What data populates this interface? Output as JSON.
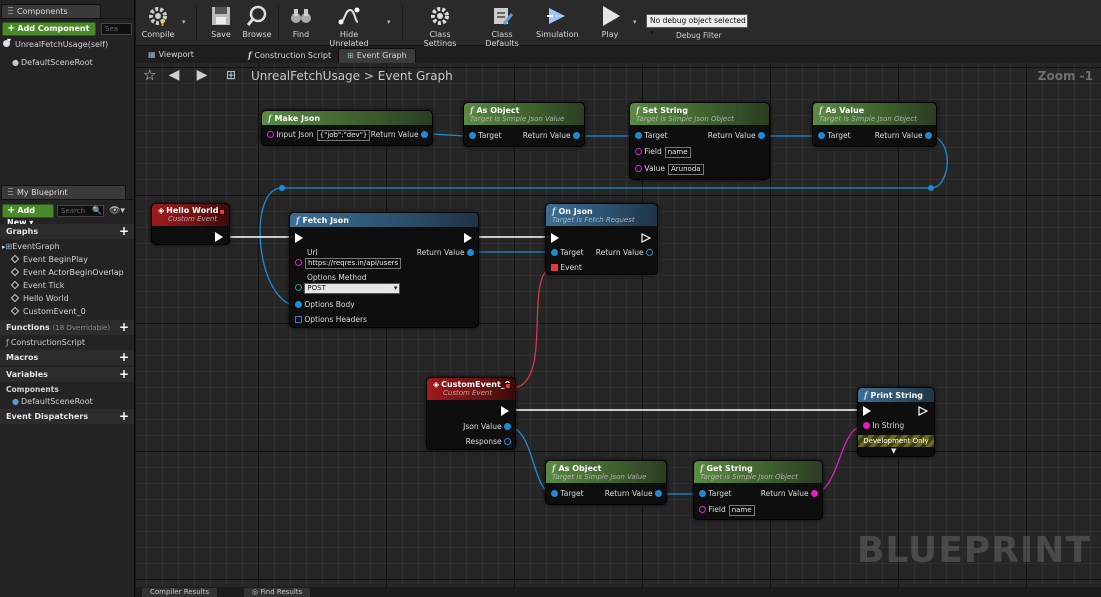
{
  "components_panel": {
    "tab_label": "Components",
    "add_component_label": "Add Component",
    "search_placeholder": "Sea",
    "self_item": "UnrealFetchUsage(self)",
    "root_item": "DefaultSceneRoot"
  },
  "my_blueprint": {
    "tab_label": "My Blueprint",
    "add_new_label": "Add New",
    "search_placeholder": "Search",
    "graphs_label": "Graphs",
    "event_graph_label": "EventGraph",
    "events": [
      "Event BeginPlay",
      "Event ActorBeginOverlap",
      "Event Tick",
      "Hello World",
      "CustomEvent_0"
    ],
    "functions_label": "Functions",
    "functions_sub": "(18 Overridable)",
    "construction_script": "ConstructionScript",
    "macros_label": "Macros",
    "variables_label": "Variables",
    "components_label": "Components",
    "components_item": "DefaultSceneRoot",
    "dispatchers_label": "Event Dispatchers"
  },
  "toolbar": {
    "compile": "Compile",
    "save": "Save",
    "browse": "Browse",
    "find": "Find",
    "hide_unrelated": "Hide Unrelated",
    "class_settings": "Class Settings",
    "class_defaults": "Class Defaults",
    "simulation": "Simulation",
    "play": "Play",
    "debug_selection": "No debug object selected",
    "debug_filter": "Debug Filter"
  },
  "doc_tabs": {
    "viewport": "Viewport",
    "construction": "Construction Script",
    "event_graph": "Event Graph"
  },
  "graph": {
    "breadcrumb_root": "UnrealFetchUsage",
    "breadcrumb_sep": ">",
    "breadcrumb_leaf": "Event Graph",
    "zoom": "Zoom -1",
    "watermark": "BLUEPRINT"
  },
  "nodes": {
    "make_json": {
      "title": "Make Json",
      "in_label": "Input Json",
      "in_value": "{\"job\":\"dev\"}",
      "out_label": "Return Value"
    },
    "as_object_1": {
      "title": "As Object",
      "subtitle": "Target is Simple Json Value",
      "in_label": "Target",
      "out_label": "Return Value"
    },
    "set_string": {
      "title": "Set String",
      "subtitle": "Target is Simple Json Object",
      "target": "Target",
      "field_label": "Field",
      "field_value": "name",
      "value_label": "Value",
      "value_value": "Arunoda",
      "out_label": "Return Value"
    },
    "as_value": {
      "title": "As Value",
      "subtitle": "Target is Simple Json Object",
      "in_label": "Target",
      "out_label": "Return Value"
    },
    "hello_world": {
      "title": "Hello World",
      "subtitle": "Custom Event"
    },
    "fetch_json": {
      "title": "Fetch Json",
      "url_label": "Url",
      "url_value": "https://reqres.in/api/users",
      "method_label": "Options Method",
      "method_value": "POST",
      "body_label": "Options Body",
      "headers_label": "Options Headers",
      "out_label": "Return Value"
    },
    "on_json": {
      "title": "On Json",
      "subtitle": "Target is Fetch Request",
      "target": "Target",
      "event": "Event",
      "out_label": "Return Value"
    },
    "custom_event": {
      "title": "CustomEvent_0",
      "subtitle": "Custom Event",
      "json_value": "Json Value",
      "response": "Response"
    },
    "as_object_2": {
      "title": "As Object",
      "subtitle": "Target is Simple Json Value",
      "in_label": "Target",
      "out_label": "Return Value"
    },
    "get_string": {
      "title": "Get String",
      "subtitle": "Target is Simple Json Object",
      "target": "Target",
      "field_label": "Field",
      "field_value": "name",
      "out_label": "Return Value"
    },
    "print_string": {
      "title": "Print String",
      "in_label": "In String",
      "dev_only": "Development Only"
    }
  },
  "bottom_tabs": {
    "compiler": "Compiler Results",
    "find": "Find Results"
  },
  "colors": {
    "exec": "#ffffff",
    "object": "#1d8bd4",
    "string": "#e51ebb",
    "event_red": "#a11a1a",
    "pure_green": "#5a8b42",
    "impure_blue": "#3a6f94"
  }
}
